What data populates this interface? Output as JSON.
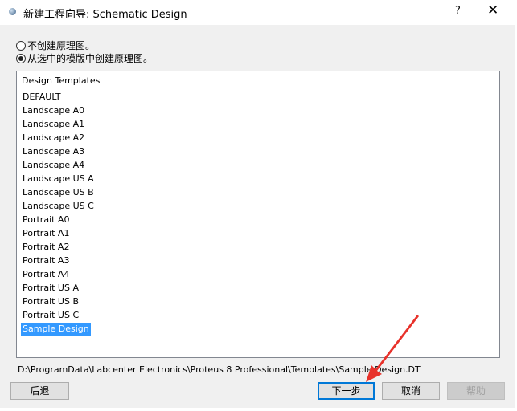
{
  "window": {
    "title": "新建工程向导: Schematic Design",
    "help": "?",
    "close": "✕"
  },
  "options": [
    {
      "label": "不创建原理图。",
      "selected": false
    },
    {
      "label": "从选中的模版中创建原理图。",
      "selected": true
    }
  ],
  "list": {
    "header": "Design Templates",
    "items": [
      "DEFAULT",
      "Landscape A0",
      "Landscape A1",
      "Landscape A2",
      "Landscape A3",
      "Landscape A4",
      "Landscape US A",
      "Landscape US B",
      "Landscape US C",
      "Portrait A0",
      "Portrait A1",
      "Portrait A2",
      "Portrait A3",
      "Portrait A4",
      "Portrait US A",
      "Portrait US B",
      "Portrait US C",
      "Sample Design"
    ],
    "selected": "Sample Design"
  },
  "path": "D:\\ProgramData\\Labcenter Electronics\\Proteus 8 Professional\\Templates\\Sample Design.DT",
  "buttons": {
    "back": "后退",
    "next": "下一步",
    "cancel": "取消",
    "help": "帮助"
  },
  "colors": {
    "selection": "#3399ff",
    "annotation_arrow": "#e8322b",
    "default_button": "#0078d7"
  }
}
